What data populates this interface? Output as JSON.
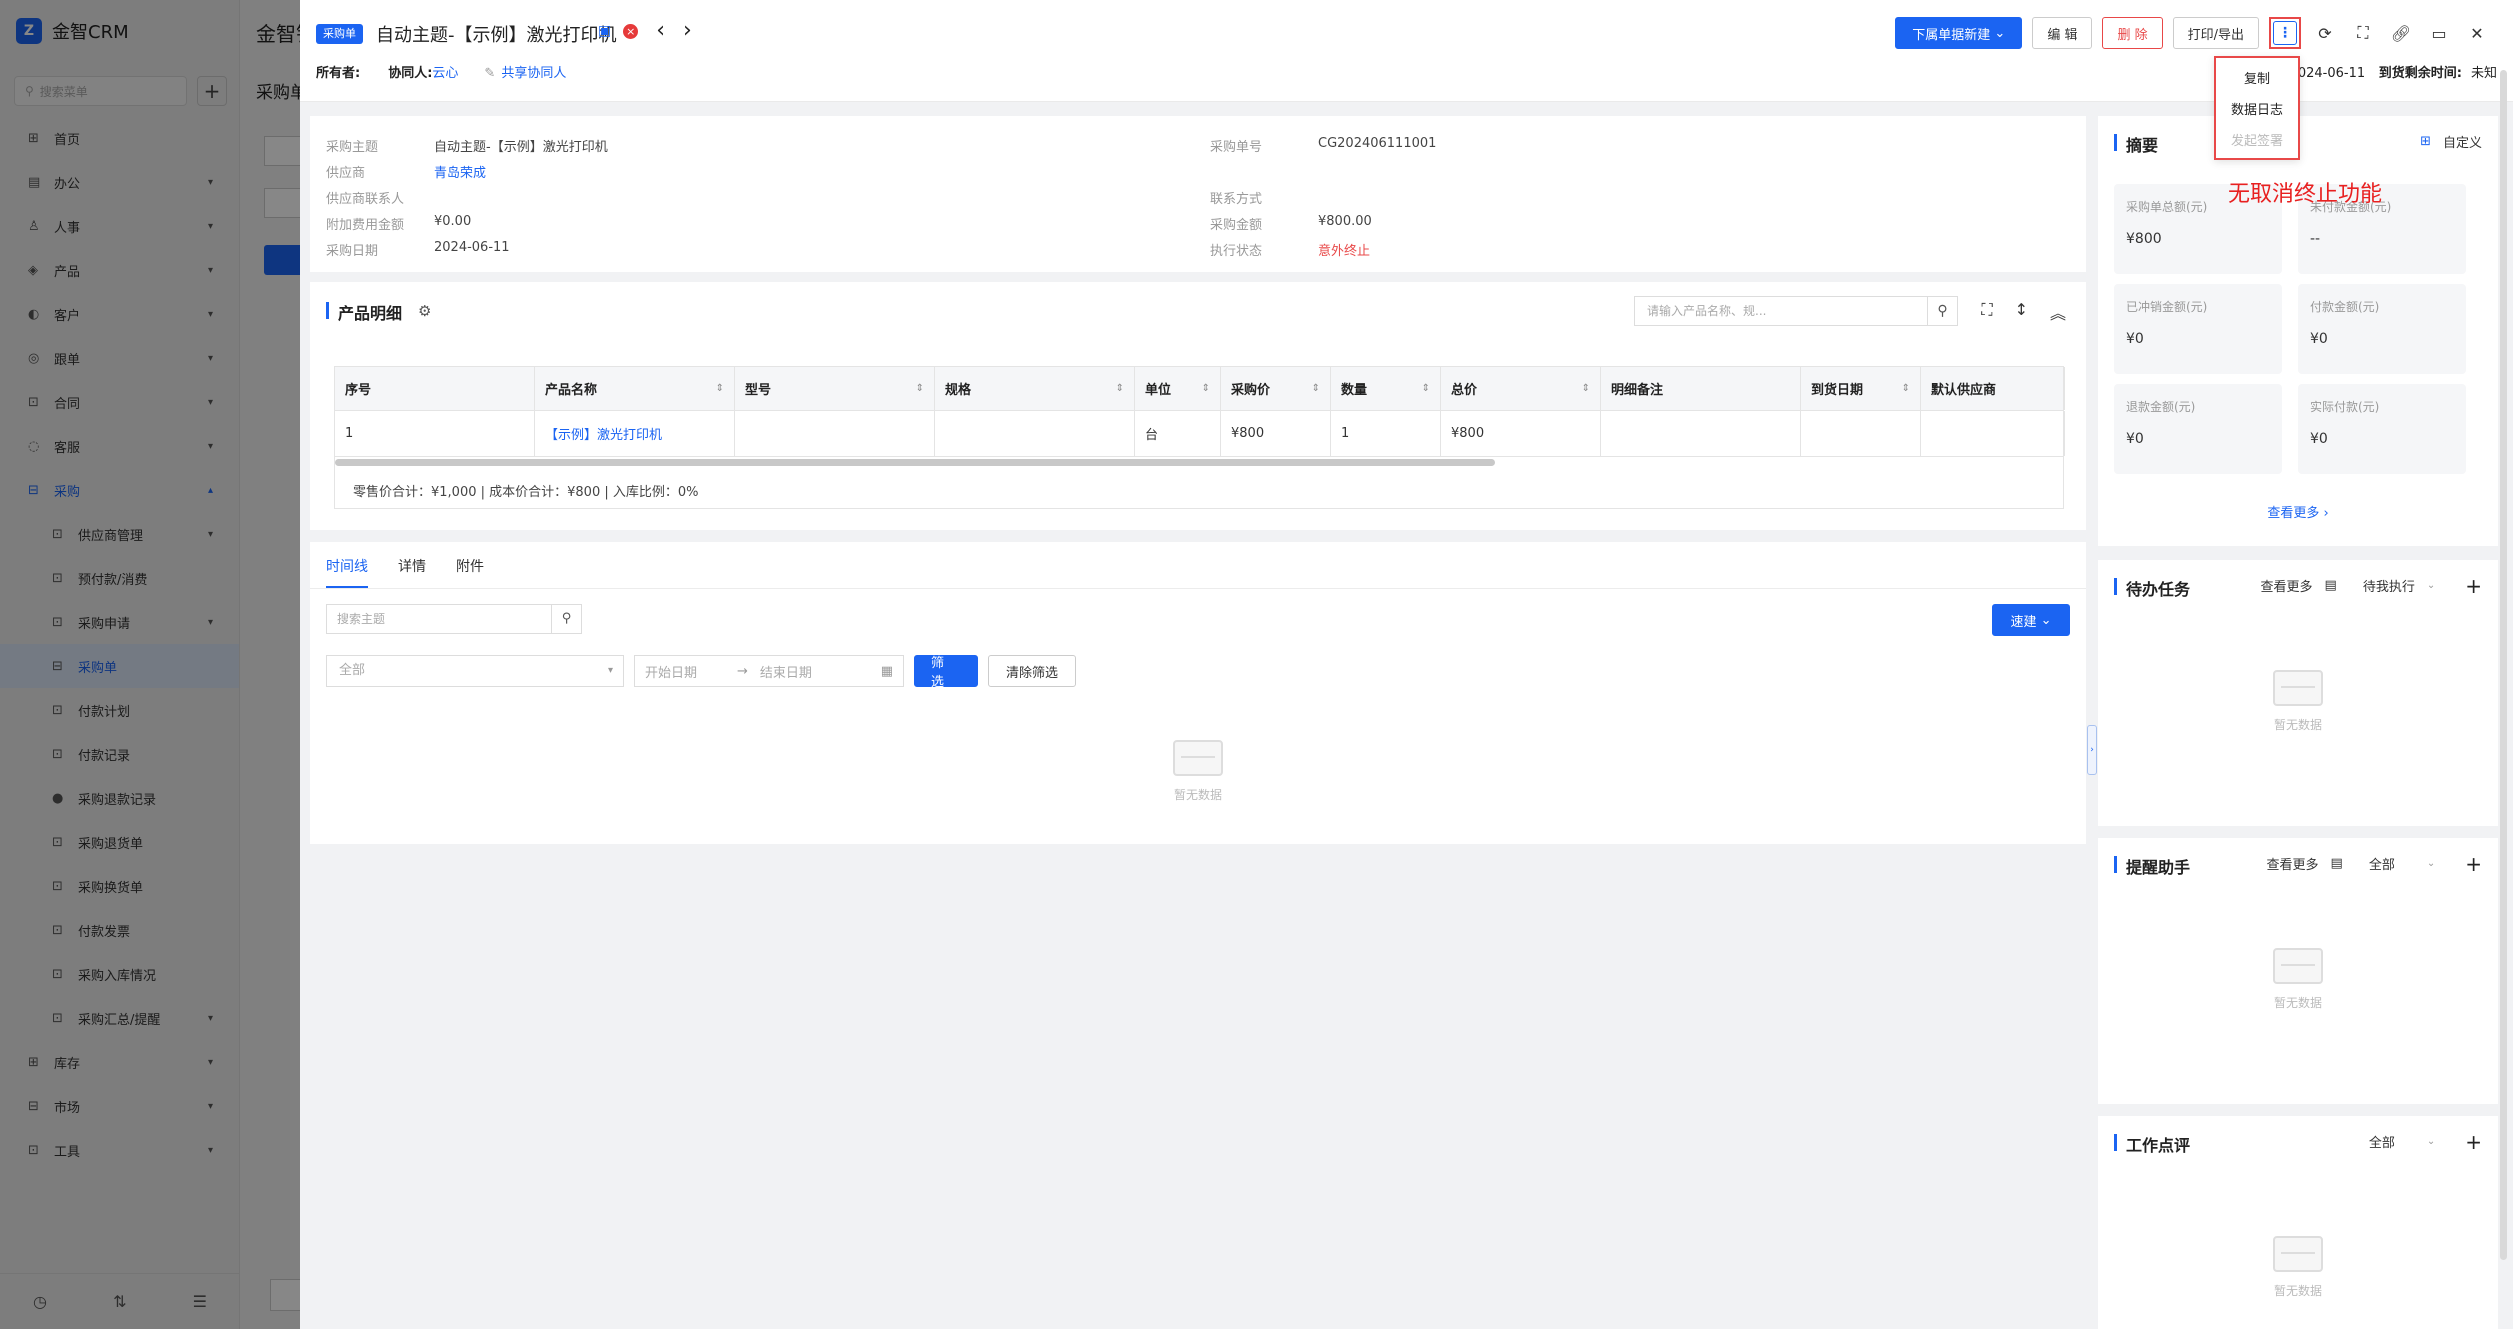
{
  "app": {
    "name": "金智CRM",
    "bg_title": "金智销",
    "bg_sub": "采购单"
  },
  "sidebar": {
    "search_placeholder": "搜索菜单",
    "items": [
      {
        "icon": "⊞",
        "label": "首页",
        "level": 0
      },
      {
        "icon": "▤",
        "label": "办公",
        "level": 0,
        "chev": "▾"
      },
      {
        "icon": "♙",
        "label": "人事",
        "level": 0,
        "chev": "▾"
      },
      {
        "icon": "◈",
        "label": "产品",
        "level": 0,
        "chev": "▾"
      },
      {
        "icon": "◐",
        "label": "客户",
        "level": 0,
        "chev": "▾"
      },
      {
        "icon": "◎",
        "label": "跟单",
        "level": 0,
        "chev": "▾"
      },
      {
        "icon": "⊡",
        "label": "合同",
        "level": 0,
        "chev": "▾"
      },
      {
        "icon": "◌",
        "label": "客服",
        "level": 0,
        "chev": "▾"
      },
      {
        "icon": "⊟",
        "label": "采购",
        "level": 0,
        "chev": "▴",
        "open": true
      },
      {
        "icon": "⊡",
        "label": "供应商管理",
        "level": 1,
        "chev": "▾"
      },
      {
        "icon": "⊡",
        "label": "预付款/消费",
        "level": 1
      },
      {
        "icon": "⊡",
        "label": "采购申请",
        "level": 1,
        "chev": "▾"
      },
      {
        "icon": "⊟",
        "label": "采购单",
        "level": 1,
        "active": true
      },
      {
        "icon": "⊡",
        "label": "付款计划",
        "level": 1
      },
      {
        "icon": "⊡",
        "label": "付款记录",
        "level": 1
      },
      {
        "icon": "●",
        "label": "采购退款记录",
        "level": 1
      },
      {
        "icon": "⊡",
        "label": "采购退货单",
        "level": 1
      },
      {
        "icon": "⊡",
        "label": "采购换货单",
        "level": 1
      },
      {
        "icon": "⊡",
        "label": "付款发票",
        "level": 1
      },
      {
        "icon": "⊡",
        "label": "采购入库情况",
        "level": 1
      },
      {
        "icon": "⊡",
        "label": "采购汇总/提醒",
        "level": 1,
        "chev": "▾"
      },
      {
        "icon": "⊞",
        "label": "库存",
        "level": 0,
        "chev": "▾"
      },
      {
        "icon": "⊟",
        "label": "市场",
        "level": 0,
        "chev": "▾"
      },
      {
        "icon": "⊡",
        "label": "工具",
        "level": 0,
        "chev": "▾"
      }
    ],
    "bottom_icons": [
      "◷",
      "⇅",
      "☰"
    ]
  },
  "drawer": {
    "tag": "采购单",
    "title": "自动主题-【示例】激光打印机",
    "owner_label": "所有者:",
    "collab_label": "协同人:",
    "collab_value": "云心",
    "share_label": "共享协同人",
    "actions": {
      "new_from": "下属单据新建",
      "edit": "编 辑",
      "delete": "删 除",
      "print": "打印/导出",
      "more": "⋮"
    },
    "right_info": {
      "date_part": "024-06-11",
      "remain_label": "到货剩余时间:",
      "remain_value": "未知"
    },
    "dropdown": [
      {
        "label": "复制",
        "disabled": false
      },
      {
        "label": "数据日志",
        "disabled": false
      },
      {
        "label": "发起签署",
        "disabled": true
      }
    ],
    "annotation": "无取消终止功能"
  },
  "info": {
    "left": [
      {
        "k": "采购主题",
        "v": "自动主题-【示例】激光打印机",
        "type": ""
      },
      {
        "k": "供应商",
        "v": "青岛荣成",
        "type": "link"
      },
      {
        "k": "供应商联系人",
        "v": "",
        "type": ""
      },
      {
        "k": "附加费用金额",
        "v": "¥0.00",
        "type": ""
      },
      {
        "k": "采购日期",
        "v": "2024-06-11",
        "type": ""
      }
    ],
    "right": [
      {
        "k": "采购单号",
        "v": "CG202406111001",
        "type": ""
      },
      {
        "k": "",
        "v": "",
        "type": ""
      },
      {
        "k": "联系方式",
        "v": "",
        "type": ""
      },
      {
        "k": "采购金额",
        "v": "¥800.00",
        "type": ""
      },
      {
        "k": "执行状态",
        "v": "意外终止",
        "type": "red"
      }
    ]
  },
  "products": {
    "title": "产品明细",
    "search_placeholder": "请输入产品名称、规...",
    "columns": [
      "序号",
      "产品名称",
      "型号",
      "规格",
      "单位",
      "采购价",
      "数量",
      "总价",
      "明细备注",
      "到货日期",
      "默认供应商"
    ],
    "rows": [
      [
        "1",
        "【示例】激光打印机",
        "",
        "",
        "台",
        "¥800",
        "1",
        "¥800",
        "",
        "",
        ""
      ]
    ],
    "summary": "零售价合计：¥1,000 |   成本价合计：¥800 |   入库比例：0%"
  },
  "timeline": {
    "tabs": [
      "时间线",
      "详情",
      "附件"
    ],
    "search_placeholder": "搜索主题",
    "quick_new": "速建",
    "select_all": "全部",
    "start_date": "开始日期",
    "end_date": "结束日期",
    "filter": "筛 选",
    "clear": "清除筛选",
    "empty": "暂无数据"
  },
  "summary_panel": {
    "title": "摘要",
    "customize": "自定义",
    "stats": [
      {
        "label": "采购单总额(元)",
        "value": "¥800"
      },
      {
        "label": "未付款金额(元)",
        "value": "--"
      },
      {
        "label": "已冲销金额(元)",
        "value": "¥0"
      },
      {
        "label": "付款金额(元)",
        "value": "¥0"
      },
      {
        "label": "退款金额(元)",
        "value": "¥0"
      },
      {
        "label": "实际付款(元)",
        "value": "¥0"
      }
    ],
    "see_more": "查看更多"
  },
  "todo": {
    "title": "待办任务",
    "see_more": "查看更多",
    "filter": "待我执行",
    "empty": "暂无数据"
  },
  "reminder": {
    "title": "提醒助手",
    "see_more": "查看更多",
    "filter": "全部",
    "empty": "暂无数据"
  },
  "review": {
    "title": "工作点评",
    "filter": "全部",
    "empty": "暂无数据"
  }
}
